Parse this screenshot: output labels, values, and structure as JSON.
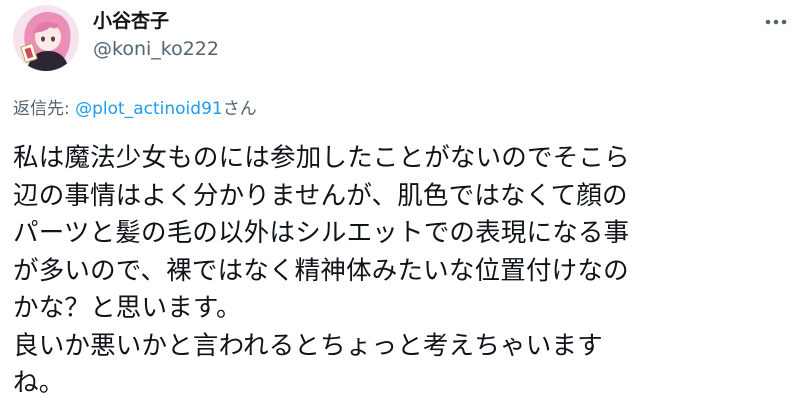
{
  "author": {
    "display_name": "小谷杏子",
    "handle": "@koni_ko222"
  },
  "reply": {
    "prefix": "返信先: ",
    "mention": "@plot_actinoid91",
    "suffix": "さん"
  },
  "tweet": {
    "lines": [
      "私は魔法少女ものには参加したことがないのでそこら",
      "辺の事情はよく分かりませんが、肌色ではなくて顔の",
      "パーツと髪の毛の以外はシルエットでの表現になる事",
      "が多いので、裸ではなく精神体みたいな位置付けなの",
      "かな？と思います。",
      "良いか悪いかと言われるとちょっと考えちゃいます",
      "ね。"
    ]
  },
  "icons": {
    "more": "more-horizontal-icon",
    "avatar": "avatar-illustration"
  },
  "colors": {
    "text": "#0f1419",
    "secondary": "#536471",
    "link": "#1d9bf0"
  }
}
